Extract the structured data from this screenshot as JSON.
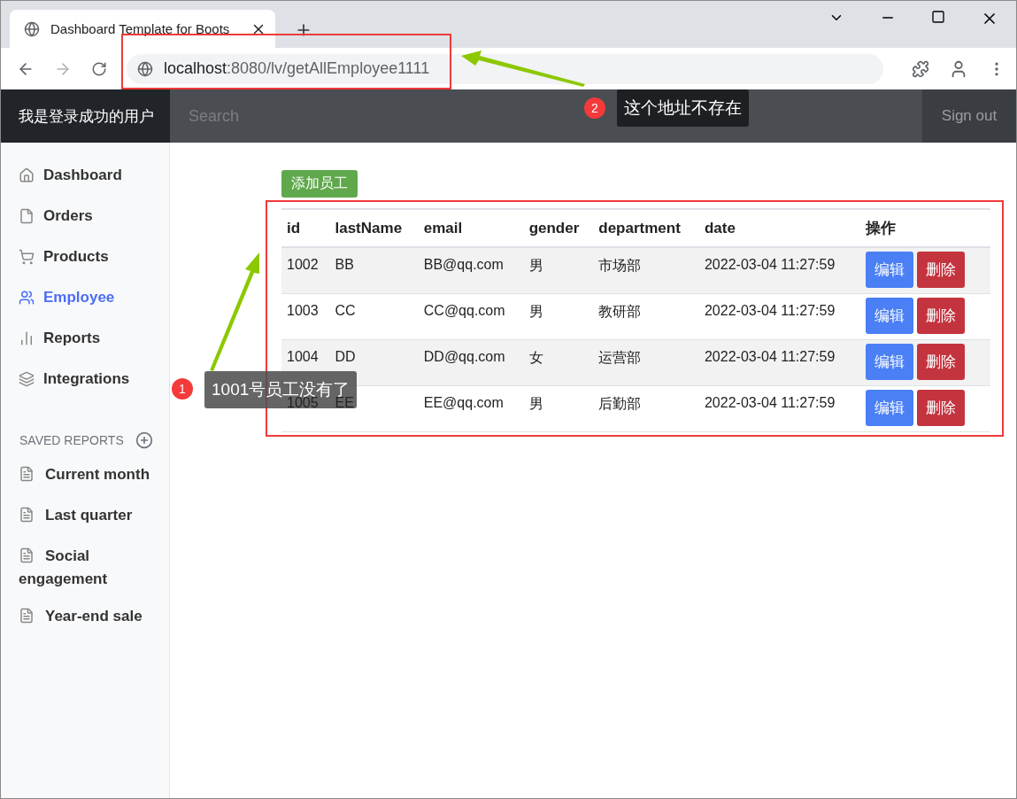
{
  "browser": {
    "tab_title": "Dashboard Template for Boots",
    "url_host": "localhost",
    "url_path": ":8080/lv/getAllEmployee1111"
  },
  "navbar": {
    "brand": "我是登录成功的用户",
    "search_placeholder": "Search",
    "sign_out": "Sign out"
  },
  "sidebar": {
    "items": [
      {
        "label": "Dashboard",
        "selected": false
      },
      {
        "label": "Orders",
        "selected": false
      },
      {
        "label": "Products",
        "selected": false
      },
      {
        "label": "Employee",
        "selected": true
      },
      {
        "label": "Reports",
        "selected": false
      },
      {
        "label": "Integrations",
        "selected": false
      }
    ],
    "saved_reports": {
      "heading": "SAVED REPORTS",
      "items": [
        "Current month",
        "Last quarter",
        "Social engagement",
        "Year-end sale"
      ]
    }
  },
  "main": {
    "add_button": "添加员工",
    "table": {
      "columns": [
        "id",
        "lastName",
        "email",
        "gender",
        "department",
        "date",
        "操作"
      ],
      "rows": [
        {
          "cells": [
            "1002",
            "BB",
            "BB@qq.com",
            "男",
            "市场部",
            "2022-03-04 11:27:59"
          ],
          "actions": [
            "编辑",
            "删除"
          ]
        },
        {
          "cells": [
            "1003",
            "CC",
            "CC@qq.com",
            "男",
            "教研部",
            "2022-03-04 11:27:59"
          ],
          "actions": [
            "编辑",
            "删除"
          ]
        },
        {
          "cells": [
            "1004",
            "DD",
            "DD@qq.com",
            "女",
            "运营部",
            "2022-03-04 11:27:59"
          ],
          "actions": [
            "编辑",
            "删除"
          ]
        },
        {
          "cells": [
            "1005",
            "EE",
            "EE@qq.com",
            "男",
            "后勤部",
            "2022-03-04 11:27:59"
          ],
          "actions": [
            "编辑",
            "删除"
          ]
        }
      ]
    }
  },
  "annotations": [
    {
      "number": "1",
      "text": "1001号员工没有了"
    },
    {
      "number": "2",
      "text": "这个地址不存在"
    }
  ]
}
